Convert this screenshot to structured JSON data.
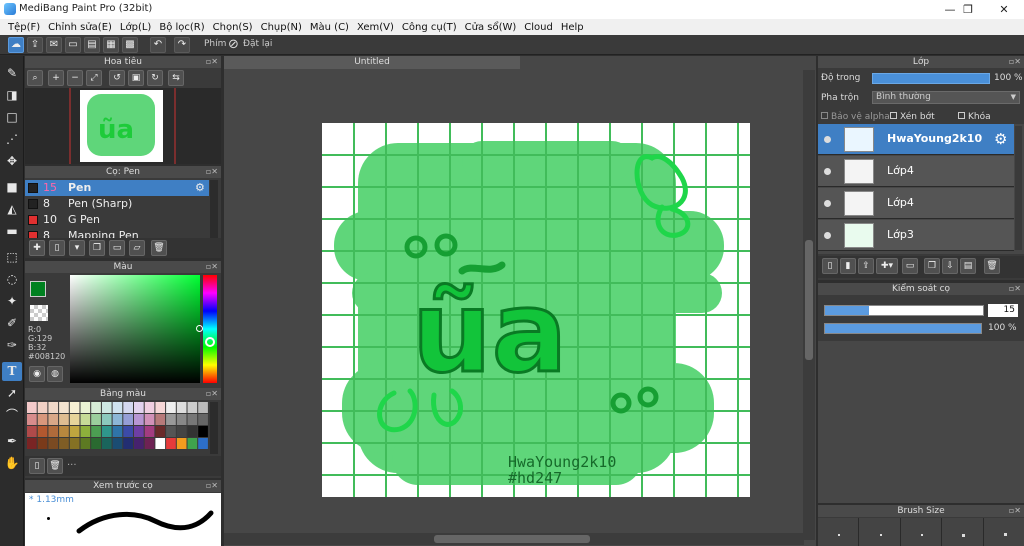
{
  "window": {
    "title": "MediBang Paint Pro (32bit)",
    "minimize": "—",
    "restore": "❐",
    "close": "✕"
  },
  "menu": [
    "Tệp(F)",
    "Chỉnh sửa(E)",
    "Lớp(L)",
    "Bộ lọc(R)",
    "Chọn(S)",
    "Chụp(N)",
    "Màu (C)",
    "Xem(V)",
    "Công cụ(T)",
    "Cửa sổ(W)",
    "Cloud",
    "Help"
  ],
  "toolbar": {
    "pen_label": "Phím",
    "reset_label": "Đặt lại"
  },
  "navigator": {
    "title": "Hoa tiêu"
  },
  "canvas": {
    "tab": "Untitled",
    "watermark1": "HwaYoung2k10",
    "watermark2": "#hd247",
    "text_art": "ũa"
  },
  "brush_panel": {
    "title": "Cọ: Pen",
    "items": [
      {
        "size": "15",
        "name": "Pen",
        "color": "#222222"
      },
      {
        "size": "8",
        "name": "Pen (Sharp)",
        "color": "#222222"
      },
      {
        "size": "10",
        "name": "G Pen",
        "color": "#e03030"
      },
      {
        "size": "8",
        "name": "Mapping Pen",
        "color": "#e03030"
      }
    ]
  },
  "color_panel": {
    "title": "Màu",
    "r": "R:0",
    "g": "G:129",
    "b": "B:32",
    "hex": "#008120",
    "fg": "#008120"
  },
  "palette_panel": {
    "title": "Bảng màu",
    "more": "···"
  },
  "brush_preview": {
    "title": "Xem trước cọ",
    "size": "* 1.13mm"
  },
  "layer_panel": {
    "title": "Lớp",
    "opacity_label": "Độ trong",
    "opacity_value": "100 %",
    "blend_label": "Pha trộn",
    "blend_value": "Bình thường",
    "protect_alpha": "Bảo vệ alpha",
    "clipping": "Xén bớt",
    "lock": "Khóa",
    "layers": [
      "HwaYoung2k10",
      "Lớp4",
      "Lớp4",
      "Lớp3"
    ]
  },
  "brush_control": {
    "title": "Kiểm soát cọ",
    "size_value": "15",
    "opacity_value": "100 %",
    "size_level": 0.28,
    "opacity_level": 1.0
  },
  "brush_size": {
    "title": "Brush Size"
  }
}
